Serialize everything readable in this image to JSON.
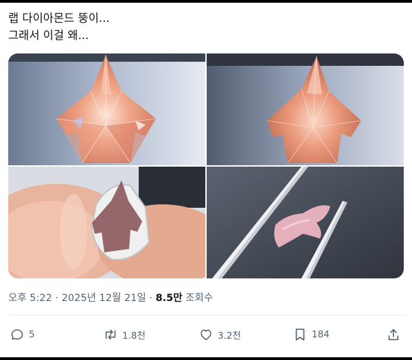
{
  "tweet": {
    "lines": [
      "랩 다이아몬드 뚱이...",
      "그래서 이걸 왜..."
    ]
  },
  "media": [
    {
      "name": "pink diamond shaped like a fighter jet, front view"
    },
    {
      "name": "pink diamond fighter jet, angled view"
    },
    {
      "name": "pink diamond jet held in fingers inside a metal setting"
    },
    {
      "name": "pink crystal jet held by tweezers"
    }
  ],
  "meta": {
    "time": "오후 5:22",
    "separator1": " · ",
    "date": "2025년 12월 21일",
    "separator2": " · ",
    "views": "8.5만",
    "views_label": " 조회수"
  },
  "actions": {
    "reply_count": "5",
    "retweet_count": "1.8천",
    "like_count": "3.2천",
    "bookmark_count": "184"
  },
  "colors": {
    "text": "#0f1419",
    "secondary": "#536471",
    "diamond_pink": "#e8957f"
  }
}
